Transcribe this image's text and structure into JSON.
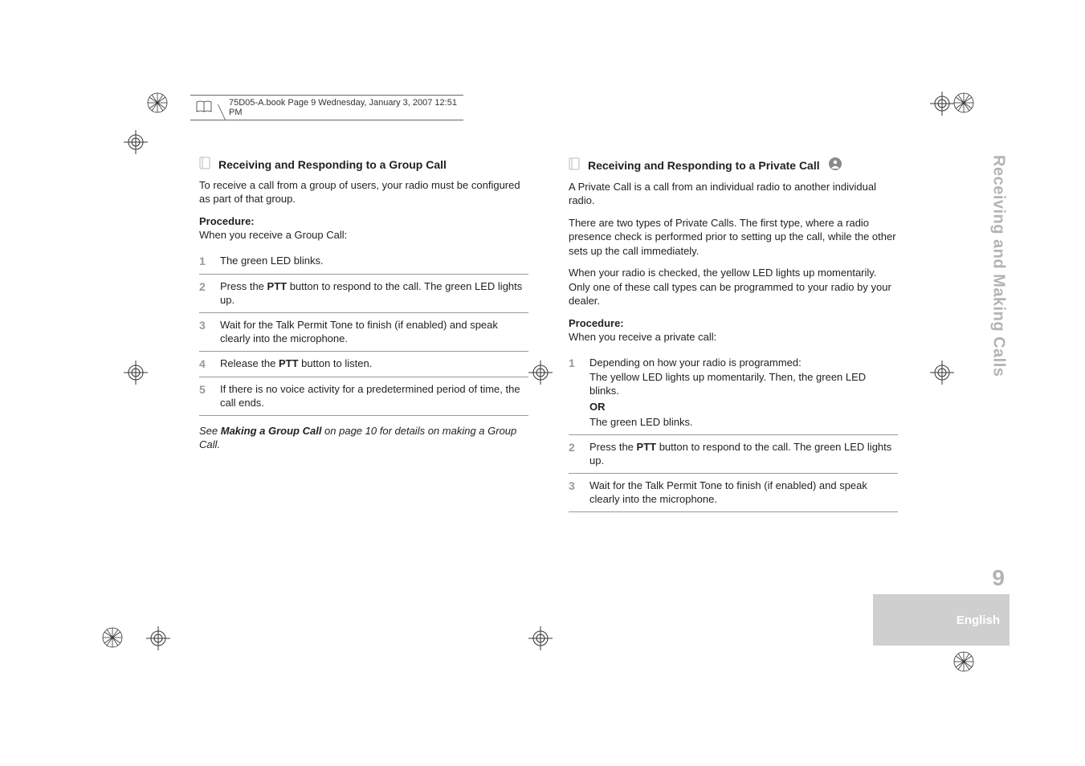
{
  "fm_header": {
    "text": "75D05-A.book  Page 9  Wednesday, January 3, 2007  12:51 PM"
  },
  "left": {
    "heading": "Receiving and Responding to a Group Call",
    "intro": "To receive a call from a group of users, your radio must be configured as part of that group.",
    "procedure_label": "Procedure:",
    "procedure_intro": "When you receive a Group Call:",
    "steps": [
      {
        "n": "1",
        "html": "The green LED blinks."
      },
      {
        "n": "2",
        "html": "Press the <span class=\"strong\">PTT</span> button to respond to the call. The green LED lights up."
      },
      {
        "n": "3",
        "html": "Wait for the Talk Permit Tone to finish (if enabled) and speak clearly into the microphone."
      },
      {
        "n": "4",
        "html": "Release the <span class=\"strong\">PTT</span> button to listen."
      },
      {
        "n": "5",
        "html": "If there is no voice activity for a predetermined period of time, the call ends."
      }
    ],
    "see_prefix": "See ",
    "see_bold": "Making a Group Call",
    "see_suffix": " on page 10 for details on making a Group Call."
  },
  "right": {
    "heading": "Receiving and Responding to a Private Call",
    "p1": "A Private Call is a call from an individual radio to another individual radio.",
    "p2": "There are two types of Private Calls. The first type, where a radio presence check is performed prior to setting up the call, while the other sets up the call immediately.",
    "p3": "When your radio is checked, the yellow LED lights up momentarily. Only one of these call types can be programmed to your radio by your dealer.",
    "procedure_label": "Procedure:",
    "procedure_intro": "When you receive a private call:",
    "steps": [
      {
        "n": "1",
        "html": "Depending on how your radio is programmed:<br>The yellow LED lights up momentarily. Then, the green LED blinks.<br><span class=\"or\">OR</span>The green LED blinks."
      },
      {
        "n": "2",
        "html": "Press the <span class=\"strong\">PTT</span> button to respond to the call. The green LED lights up."
      },
      {
        "n": "3",
        "html": "Wait for the Talk Permit Tone to finish (if enabled) and speak clearly into the microphone."
      }
    ]
  },
  "side": {
    "running_title": "Receiving and Making Calls",
    "page_number": "9",
    "language": "English"
  }
}
